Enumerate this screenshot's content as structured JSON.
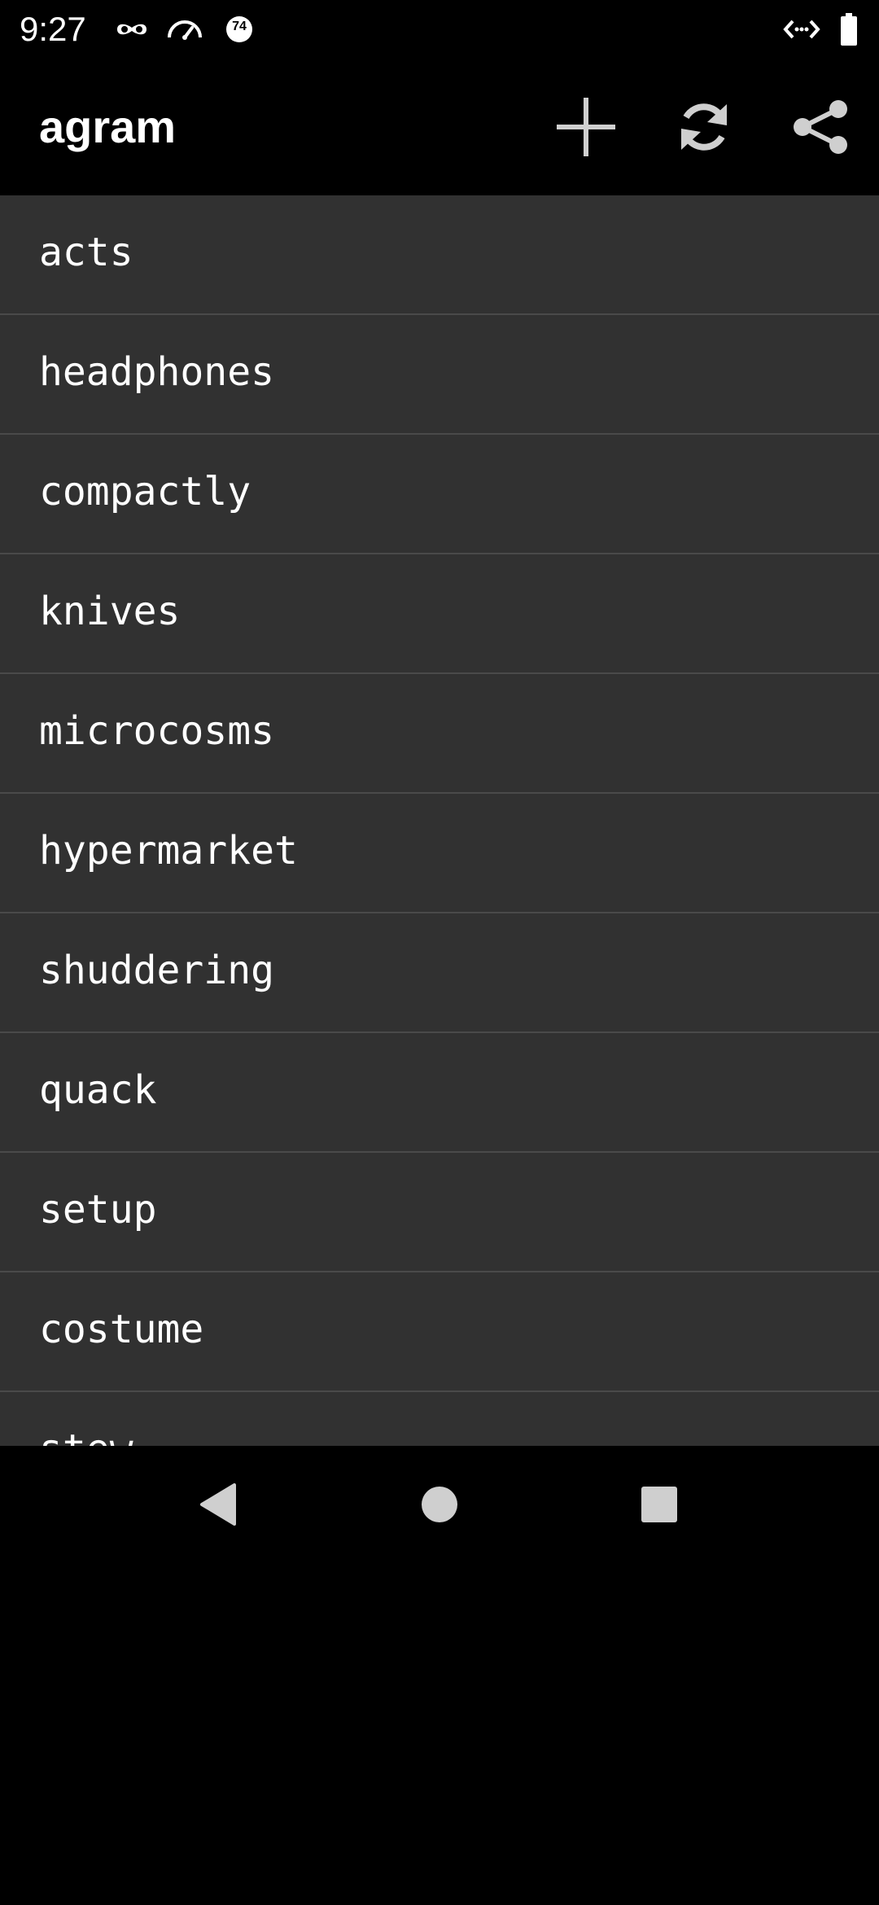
{
  "status_bar": {
    "time": "9:27",
    "battery_badge": "74",
    "icons": [
      "incognito-icon",
      "speedometer-icon",
      "battery-saver-icon",
      "dev-mode-icon",
      "battery-icon"
    ]
  },
  "app_bar": {
    "title": "agram",
    "actions": [
      "add-icon",
      "refresh-icon",
      "share-icon"
    ]
  },
  "list": {
    "items": [
      "acts",
      "headphones",
      "compactly",
      "knives",
      "microcosms",
      "hypermarket",
      "shuddering",
      "quack",
      "setup",
      "costume",
      "stew"
    ]
  },
  "nav_bar": {
    "buttons": [
      "back-icon",
      "home-icon",
      "recents-icon"
    ]
  },
  "colors": {
    "background": "#000000",
    "list_background": "#313131",
    "divider": "#4a4a4a",
    "text": "#ffffff",
    "icon": "#cfcfcf"
  }
}
